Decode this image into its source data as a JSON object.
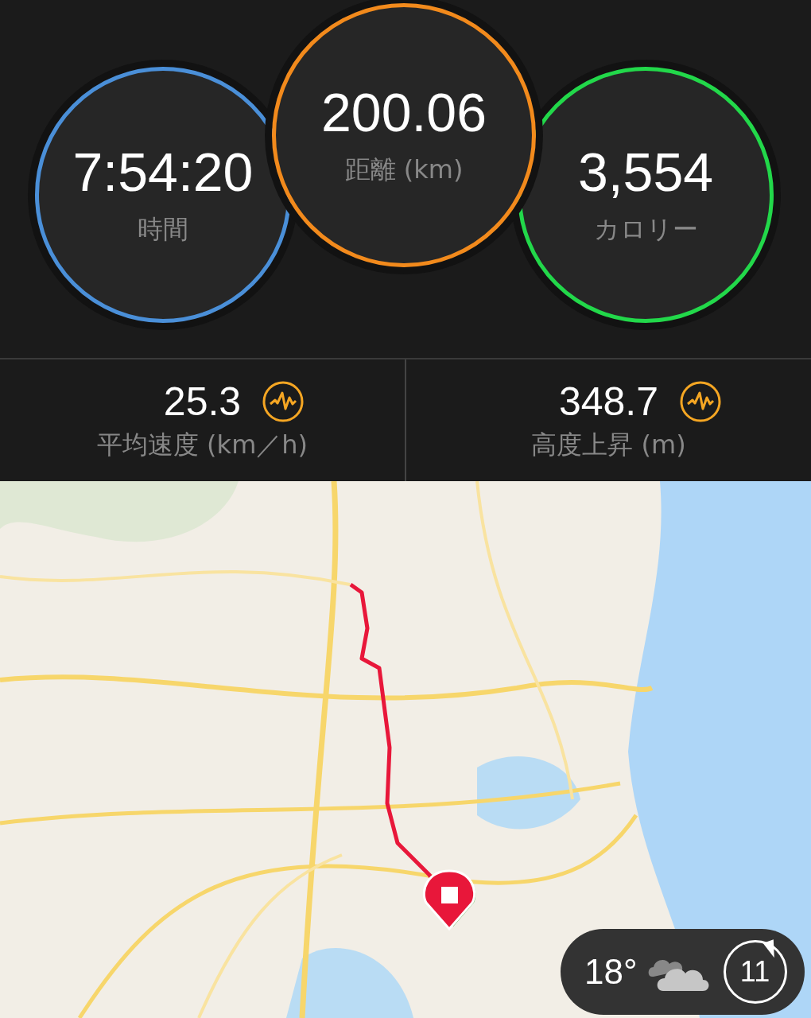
{
  "summary_rings": [
    {
      "value": "7:54:20",
      "label": "時間",
      "color": "#4a8fd8",
      "featured": false
    },
    {
      "value": "200.06",
      "label": "距離 (km)",
      "color": "#f28a1c",
      "featured": true
    },
    {
      "value": "3,554",
      "label": "カロリー",
      "color": "#22d84a",
      "featured": false
    }
  ],
  "stats": [
    {
      "value": "25.3",
      "label": "平均速度 (km／h)"
    },
    {
      "value": "348.7",
      "label": "高度上昇 (m)"
    }
  ],
  "map": {
    "kind": "picture",
    "weather": {
      "temperature": "18°",
      "wind": "11"
    }
  }
}
